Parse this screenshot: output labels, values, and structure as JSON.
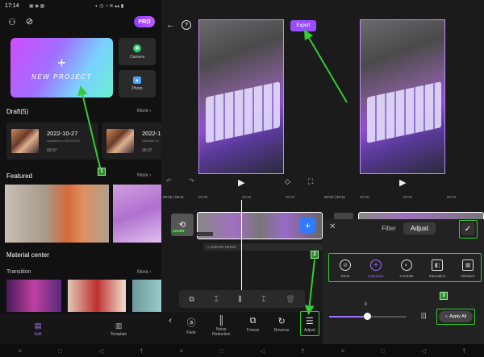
{
  "status": {
    "time": "17:14",
    "battery": "▮"
  },
  "home": {
    "pro_label": "PRO",
    "new_project": "NEW PROJECT",
    "camera": "Camera",
    "photo": "Photo",
    "drafts_title": "Draft(5)",
    "more": "More",
    "draft1": {
      "date": "2022-10-27",
      "updated": "Updated on 2022/10/27",
      "duration": "00:37"
    },
    "draft2": {
      "date": "2022-1",
      "updated": "Updated on",
      "duration": "00:37"
    },
    "featured": "Featured",
    "material_center": "Material center",
    "transition": "Transition",
    "nav_edit": "Edit",
    "nav_template": "Template"
  },
  "editor": {
    "export": "Export",
    "time_current": "00:02",
    "time_total": "00:11",
    "ruler": [
      "00:00",
      "00:02",
      "00:04"
    ],
    "ruler2": [
      "00:00",
      "00:02",
      "00:04"
    ],
    "time2": "00:02 | 00:11",
    "cover": "COVER",
    "add_music": "ADD MY MUSIC",
    "bottom_tools": [
      {
        "icon": "‹",
        "label": ""
      },
      {
        "icon": "ⓐ",
        "label": "Fade"
      },
      {
        "icon": "║",
        "label": "Noise Reduction"
      },
      {
        "icon": "⧉",
        "label": "Freeze"
      },
      {
        "icon": "↻",
        "label": "Reverse"
      },
      {
        "icon": "☰",
        "label": "Adjust"
      }
    ]
  },
  "adjust": {
    "tabs": [
      "Filter",
      "Adjust"
    ],
    "options": [
      "None",
      "Exposure",
      "Contrast",
      "Saturation",
      "Vibrance"
    ],
    "slider_value": "0",
    "apply_all": "Apply All"
  },
  "badges": [
    "1",
    "2",
    "3",
    "4"
  ]
}
